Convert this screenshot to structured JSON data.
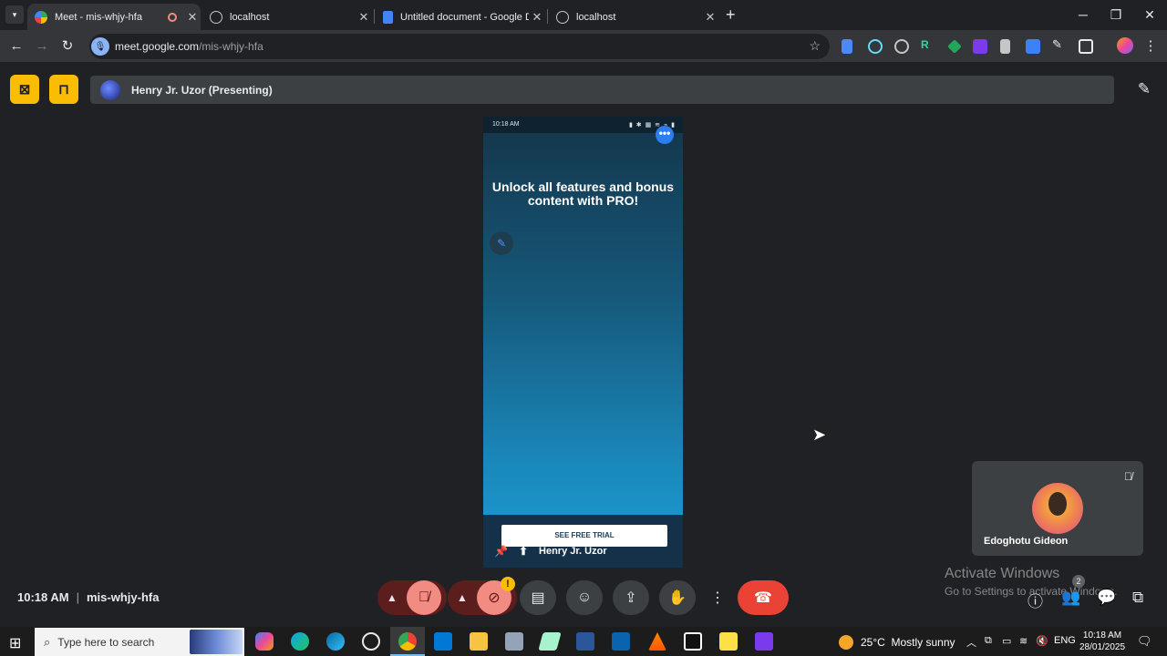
{
  "browser": {
    "tabs": [
      {
        "title": "Meet - mis-whjy-hfa",
        "active": true
      },
      {
        "title": "localhost",
        "active": false
      },
      {
        "title": "Untitled document - Google Docs",
        "active": false
      },
      {
        "title": "localhost",
        "active": false
      }
    ],
    "new_tab_label": "+",
    "url_host": "meet.google.com",
    "url_path": "/mis-whjy-hfa",
    "controls": {
      "minimize": "─",
      "restore": "❐",
      "close": "✕"
    }
  },
  "meet": {
    "presenter_label": "Henry Jr. Uzor (Presenting)",
    "shared_screen": {
      "status_time": "10:18 AM",
      "status_icons": "▮ ✱ ▦ ≋ ⌁ ▮",
      "headline": "Unlock all features and bonus content with PRO!",
      "trial_button": "SEE FREE TRIAL",
      "tile_name": "Henry Jr. Uzor"
    },
    "participant": {
      "name": "Edoghotu Gideon",
      "muted": true
    },
    "meeting_time": "10:18 AM",
    "meeting_code": "mis-whjy-hfa",
    "participant_count": "2",
    "watermark": {
      "title": "Activate Windows",
      "subtitle": "Go to Settings to activate Windows."
    }
  },
  "taskbar": {
    "search_placeholder": "Type here to search",
    "weather_temp": "25°C",
    "weather_desc": "Mostly sunny",
    "language": "ENG",
    "time": "10:18 AM",
    "date": "28/01/2025"
  },
  "colors": {
    "meet_bg": "#202124",
    "accent_yellow": "#fbbc04",
    "hangup_red": "#ea4335",
    "mic_off_pink": "#f28b82"
  }
}
